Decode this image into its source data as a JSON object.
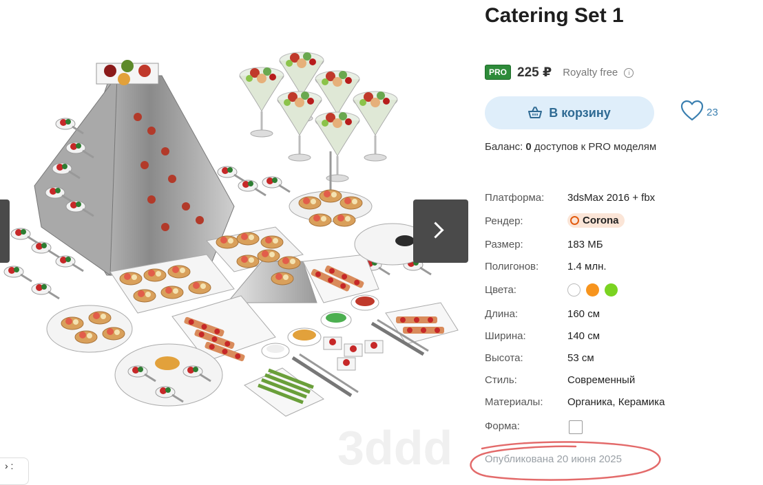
{
  "product": {
    "title": "Catering Set 1",
    "pro_badge": "PRO",
    "price": "225 ₽",
    "license": "Royalty free",
    "info_icon": "i"
  },
  "actions": {
    "cart_label": "В корзину",
    "like_count": "23"
  },
  "balance": {
    "prefix": "Баланс: ",
    "count": "0",
    "suffix": " доступов к PRO моделям"
  },
  "specs": {
    "platform": {
      "label": "Платформа:",
      "value": "3dsMax 2016 + fbx"
    },
    "render": {
      "label": "Рендер:",
      "value": "Corona"
    },
    "size": {
      "label": "Размер:",
      "value": "183 МБ"
    },
    "polygons": {
      "label": "Полигонов:",
      "value": "1.4 млн."
    },
    "colors": {
      "label": "Цвета:",
      "swatches": [
        "#ffffff",
        "#f7941d",
        "#7ad321"
      ]
    },
    "length": {
      "label": "Длина:",
      "value": "160 см"
    },
    "width": {
      "label": "Ширина:",
      "value": "140 см"
    },
    "height": {
      "label": "Высота:",
      "value": "53 см"
    },
    "style": {
      "label": "Стиль:",
      "value": "Современный"
    },
    "materials": {
      "label": "Материалы:",
      "value": "Органика, Керамика"
    },
    "shape": {
      "label": "Форма:"
    }
  },
  "published": "Опубликована 20 июня 2025",
  "viewer": {
    "watermark": "3ddd",
    "bottom_tab": "› :"
  },
  "colors": {
    "accent": "#2f6a93",
    "cart_bg": "#dfeefa",
    "pro_green": "#2e8b3a",
    "annotation_red": "#e36a6a"
  }
}
